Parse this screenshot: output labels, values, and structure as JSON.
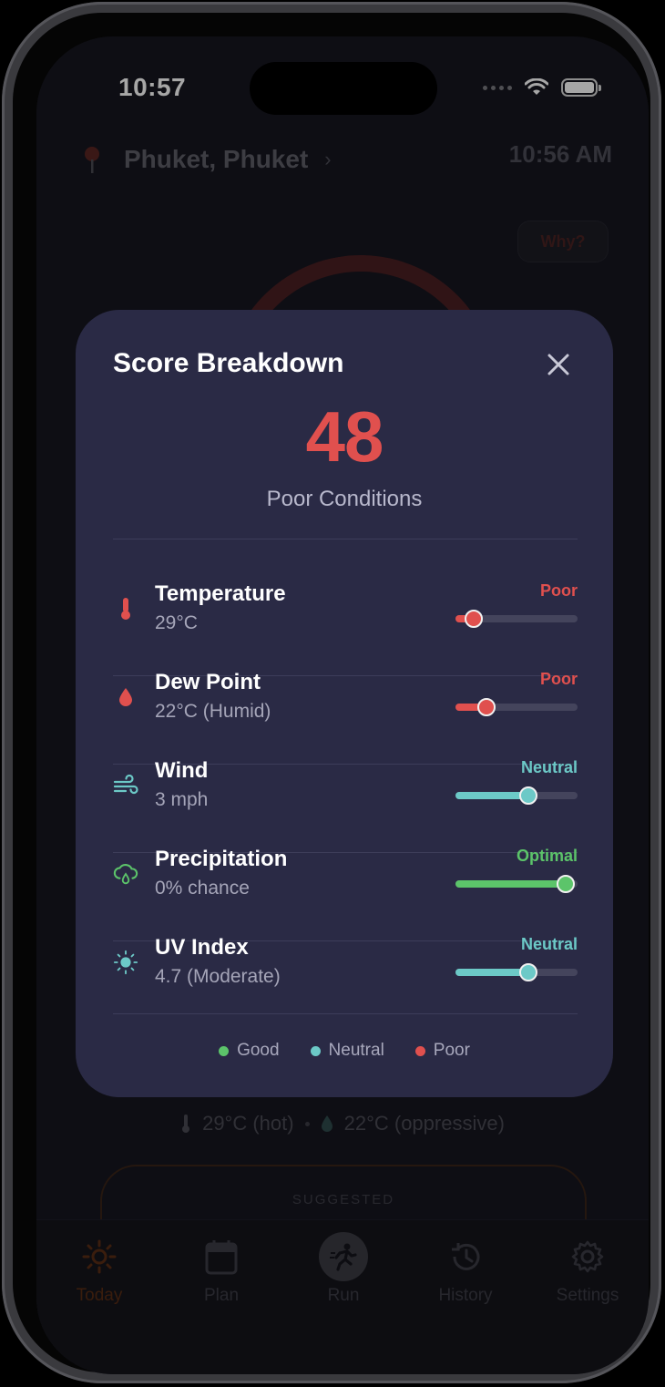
{
  "status_bar": {
    "time": "10:57"
  },
  "background": {
    "location": "Phuket, Phuket",
    "time": "10:56 AM",
    "why_button": "Why?",
    "weather_temp": "29°C (hot)",
    "weather_dew": "22°C (oppressive)",
    "suggested_label": "SUGGESTED"
  },
  "tabs": [
    {
      "label": "Today",
      "icon": "sun-icon",
      "active": true
    },
    {
      "label": "Plan",
      "icon": "calendar-icon",
      "active": false
    },
    {
      "label": "Run",
      "icon": "runner-icon",
      "active": false
    },
    {
      "label": "History",
      "icon": "history-icon",
      "active": false
    },
    {
      "label": "Settings",
      "icon": "gear-icon",
      "active": false
    }
  ],
  "modal": {
    "title": "Score Breakdown",
    "score": "48",
    "score_label": "Poor Conditions",
    "factors": [
      {
        "name": "Temperature",
        "value": "29°C",
        "status": "Poor",
        "level": 0.15,
        "icon": "thermometer-icon"
      },
      {
        "name": "Dew Point",
        "value": "22°C (Humid)",
        "status": "Poor",
        "level": 0.25,
        "icon": "droplet-icon"
      },
      {
        "name": "Wind",
        "value": "3 mph",
        "status": "Neutral",
        "level": 0.6,
        "icon": "wind-icon"
      },
      {
        "name": "Precipitation",
        "value": "0% chance",
        "status": "Optimal",
        "level": 0.9,
        "icon": "cloud-rain-icon"
      },
      {
        "name": "UV Index",
        "value": "4.7 (Moderate)",
        "status": "Neutral",
        "level": 0.6,
        "icon": "sun-icon"
      }
    ],
    "legend": [
      {
        "label": "Good",
        "color": "#5cc46a"
      },
      {
        "label": "Neutral",
        "color": "#6cc9c7"
      },
      {
        "label": "Poor",
        "color": "#e0504e"
      }
    ]
  },
  "colors": {
    "poor": "#e0504e",
    "neutral": "#6cc9c7",
    "optimal": "#5cc46a",
    "modal_bg": "#2a2a45",
    "accent": "#e06a1a"
  }
}
